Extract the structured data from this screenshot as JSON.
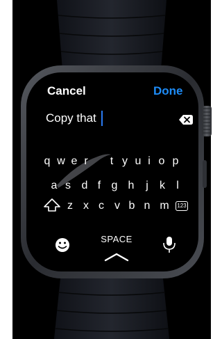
{
  "screen": {
    "cancel_label": "Cancel",
    "done_label": "Done",
    "input_text": "Copy that"
  },
  "keyboard": {
    "row1": [
      "q",
      "w",
      "e",
      "r",
      "t",
      "y",
      "u",
      "i",
      "o",
      "p"
    ],
    "row2": [
      "a",
      "s",
      "d",
      "f",
      "g",
      "h",
      "j",
      "k",
      "l"
    ],
    "row3": [
      "z",
      "x",
      "c",
      "v",
      "b",
      "n",
      "m"
    ],
    "numbers_label": "123",
    "space_label": "SPACE",
    "icons": [
      "shift-icon",
      "emoji-icon",
      "dictation-icon",
      "backspace-icon",
      "chevron-up-icon"
    ]
  },
  "colors": {
    "accent": "#1E8CF7",
    "cursor": "#2A7BF2",
    "screen_bg": "#000000",
    "text": "#FFFFFF"
  }
}
